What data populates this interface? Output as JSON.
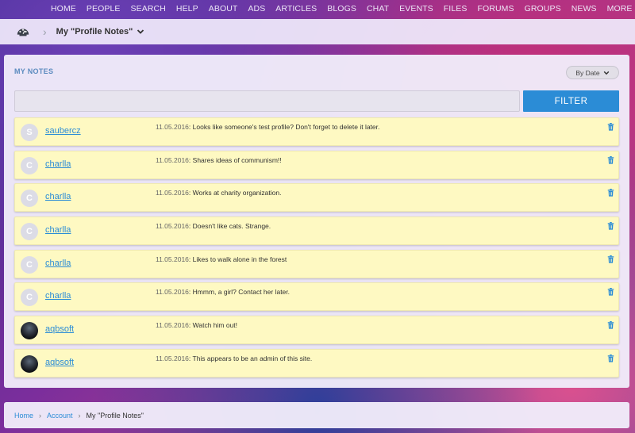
{
  "topnav": [
    "HOME",
    "PEOPLE",
    "SEARCH",
    "HELP",
    "ABOUT",
    "ADS",
    "ARTICLES",
    "BLOGS",
    "CHAT",
    "EVENTS",
    "FILES",
    "FORUMS",
    "GROUPS",
    "NEWS",
    "MORE"
  ],
  "header": {
    "title": "My \"Profile Notes\"",
    "icon": "dashboard-icon"
  },
  "panel": {
    "title": "MY NOTES",
    "sort_label": "By Date",
    "filter_value": "",
    "filter_button": "FILTER"
  },
  "notes": [
    {
      "user": "saubercz",
      "initial": "S",
      "date": "11.05.2016",
      "text": "Looks like someone's test profile? Don't forget to delete it later.",
      "avatar": "letter"
    },
    {
      "user": "charlla",
      "initial": "C",
      "date": "11.05.2016",
      "text": "Shares ideas of communism!!",
      "avatar": "letter"
    },
    {
      "user": "charlla",
      "initial": "C",
      "date": "11.05.2016",
      "text": "Works at charity organization.",
      "avatar": "letter"
    },
    {
      "user": "charlla",
      "initial": "C",
      "date": "11.05.2016",
      "text": "Doesn't like cats. Strange.",
      "avatar": "letter"
    },
    {
      "user": "charlla",
      "initial": "C",
      "date": "11.05.2016",
      "text": "Likes to walk alone in the forest",
      "avatar": "letter"
    },
    {
      "user": "charlla",
      "initial": "C",
      "date": "11.05.2016",
      "text": "Hmmm, a girl? Contact her later.",
      "avatar": "letter"
    },
    {
      "user": "aqbsoft",
      "initial": "",
      "date": "11.05.2016",
      "text": "Watch him out!",
      "avatar": "photo"
    },
    {
      "user": "aqbsoft",
      "initial": "",
      "date": "11.05.2016",
      "text": "This appears to be an admin of this site.",
      "avatar": "photo"
    }
  ],
  "breadcrumb": [
    "Home",
    "Account",
    "My \"Profile Notes\""
  ],
  "colors": {
    "accent": "#2b8cd6",
    "note_bg": "#fef9c2",
    "panel_title": "#5b8bbf"
  }
}
